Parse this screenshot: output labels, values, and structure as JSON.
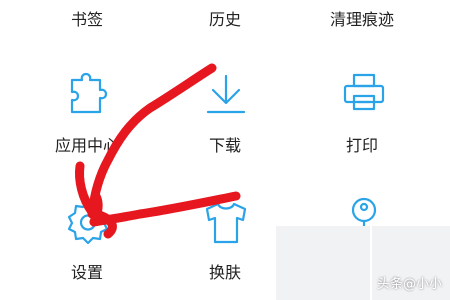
{
  "accent_color": "#2aa3e8",
  "annotation_color": "#e6171f",
  "menu": {
    "row1": [
      {
        "label": "书签"
      },
      {
        "label": "历史"
      },
      {
        "label": "清理痕迹"
      }
    ],
    "row2": [
      {
        "label": "应用中心",
        "icon": "puzzle-icon"
      },
      {
        "label": "下载",
        "icon": "download-icon"
      },
      {
        "label": "打印",
        "icon": "printer-icon"
      }
    ],
    "row3": [
      {
        "label": "设置",
        "icon": "gear-icon"
      },
      {
        "label": "换肤",
        "icon": "tshirt-icon"
      },
      {
        "label": "",
        "icon": "key-icon"
      }
    ]
  },
  "watermark": "头条@小小"
}
